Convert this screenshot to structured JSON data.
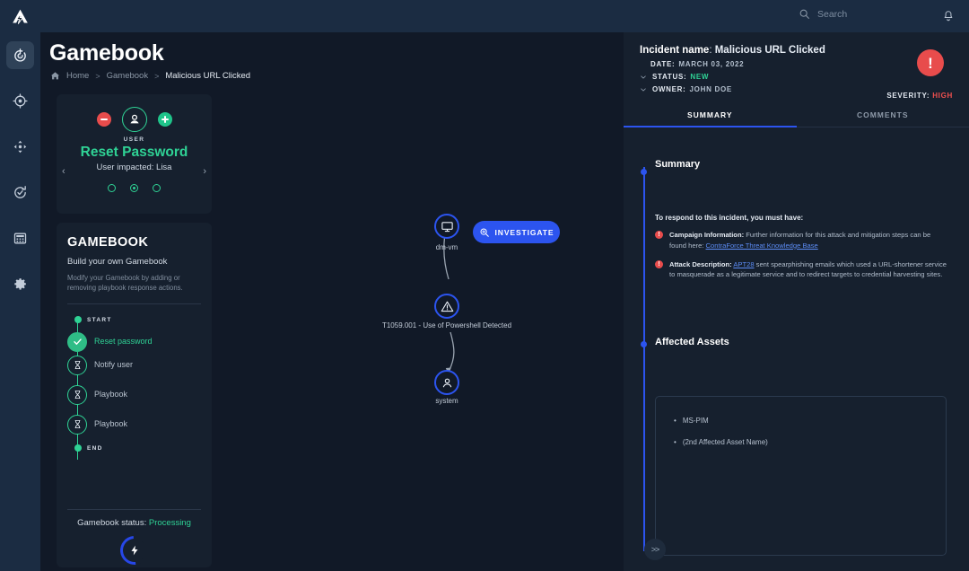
{
  "topbar": {
    "logo": "contraforce-logo",
    "search_placeholder": "Search",
    "search_value": "",
    "notifications_icon": "bell-icon"
  },
  "sidebar": {
    "items": [
      {
        "icon": "radar-icon",
        "name": "dashboard",
        "active": true
      },
      {
        "icon": "target-icon",
        "name": "detections",
        "active": false
      },
      {
        "icon": "move-arrows-icon",
        "name": "response",
        "active": false
      },
      {
        "icon": "refresh-check-icon",
        "name": "automation",
        "active": false
      },
      {
        "icon": "grid-calculator-icon",
        "name": "reports",
        "active": false
      },
      {
        "icon": "gear-icon",
        "name": "settings",
        "active": false
      }
    ]
  },
  "page": {
    "title": "Gamebook",
    "breadcrumb": [
      {
        "label": "Home",
        "current": false
      },
      {
        "label": "Gamebook",
        "current": false
      },
      {
        "label": "Malicious URL Clicked",
        "current": true
      }
    ],
    "breadcrumb_separator": ">"
  },
  "user_action_card": {
    "role_label": "USER",
    "title": "Reset Password",
    "subtitle": "User impacted: Lisa",
    "remove_icon": "minus-circle-icon",
    "add_icon": "plus-circle-icon",
    "avatar_icon": "user-icon",
    "prev_arrow": "‹",
    "next_arrow": "›",
    "dots": [
      {
        "active": false
      },
      {
        "active": true
      },
      {
        "active": false
      }
    ]
  },
  "gamebook_panel": {
    "heading": "GAMEBOOK",
    "subheading": "Build your own Gamebook",
    "description": "Modify your Gamebook by adding or removing playbook response actions.",
    "start_label": "START",
    "end_label": "END",
    "steps": [
      {
        "label": "Reset password",
        "state": "done",
        "icon": "check-icon"
      },
      {
        "label": "Notify user",
        "state": "pending",
        "icon": "hourglass-icon"
      },
      {
        "label": "Playbook",
        "state": "pending",
        "icon": "hourglass-icon"
      },
      {
        "label": "Playbook",
        "state": "pending",
        "icon": "hourglass-icon"
      }
    ],
    "status_label": "Gamebook status:",
    "status_value": "Processing",
    "spinner_icon": "lightning-bolt-icon"
  },
  "graph": {
    "investigate_label": "INVESTIGATE",
    "investigate_icon": "search-plus-icon",
    "nodes": [
      {
        "id": "dm-vm",
        "label": "dm-vm",
        "icon": "monitor-icon"
      },
      {
        "id": "technique",
        "label": "T1059.001 - Use of Powershell Detected",
        "icon": "alert-triangle-icon"
      },
      {
        "id": "system",
        "label": "system",
        "icon": "user-icon"
      }
    ]
  },
  "incident": {
    "name_label": "Incident name",
    "name_value": "Malicious URL Clicked",
    "date_label": "DATE:",
    "date_value": "MARCH 03, 2022",
    "status_label": "STATUS:",
    "status_value": "NEW",
    "owner_label": "OWNER:",
    "owner_value": "JOHN DOE",
    "severity_label": "SEVERITY:",
    "severity_value": "HIGH",
    "severity_icon": "exclamation-circle-icon",
    "severity_color": "#e84c4c",
    "chevron_icon": "chevron-down-icon"
  },
  "tabs": [
    {
      "label": "SUMMARY",
      "active": true
    },
    {
      "label": "COMMENTS",
      "active": false
    }
  ],
  "summary": {
    "section_title": "Summary",
    "lead": "To respond to this incident, you must have:",
    "bullets": [
      {
        "title": "Campaign Information:",
        "text_before": " Further information for this attack and mitigation steps can be found here: ",
        "link": "ContraForce Threat Knowledge Base",
        "text_after": ""
      },
      {
        "title": "Attack Description:",
        "text_before": " ",
        "link": "APT28",
        "text_after": " sent spearphishing emails which used a URL-shortener service to masquerade as a legitimate service and to redirect targets to credential harvesting sites."
      }
    ]
  },
  "affected_assets": {
    "section_title": "Affected Assets",
    "items": [
      "MS-PIM",
      "(2nd Affected Asset Name)"
    ]
  },
  "footer": {
    "next_label": ">>"
  },
  "colors": {
    "accent_blue": "#2c54ef",
    "accent_green": "#2fd295",
    "danger_red": "#e84c4c",
    "panel_bg": "#16202e",
    "main_bg": "#111927",
    "rail_bg": "#1b2c42"
  }
}
